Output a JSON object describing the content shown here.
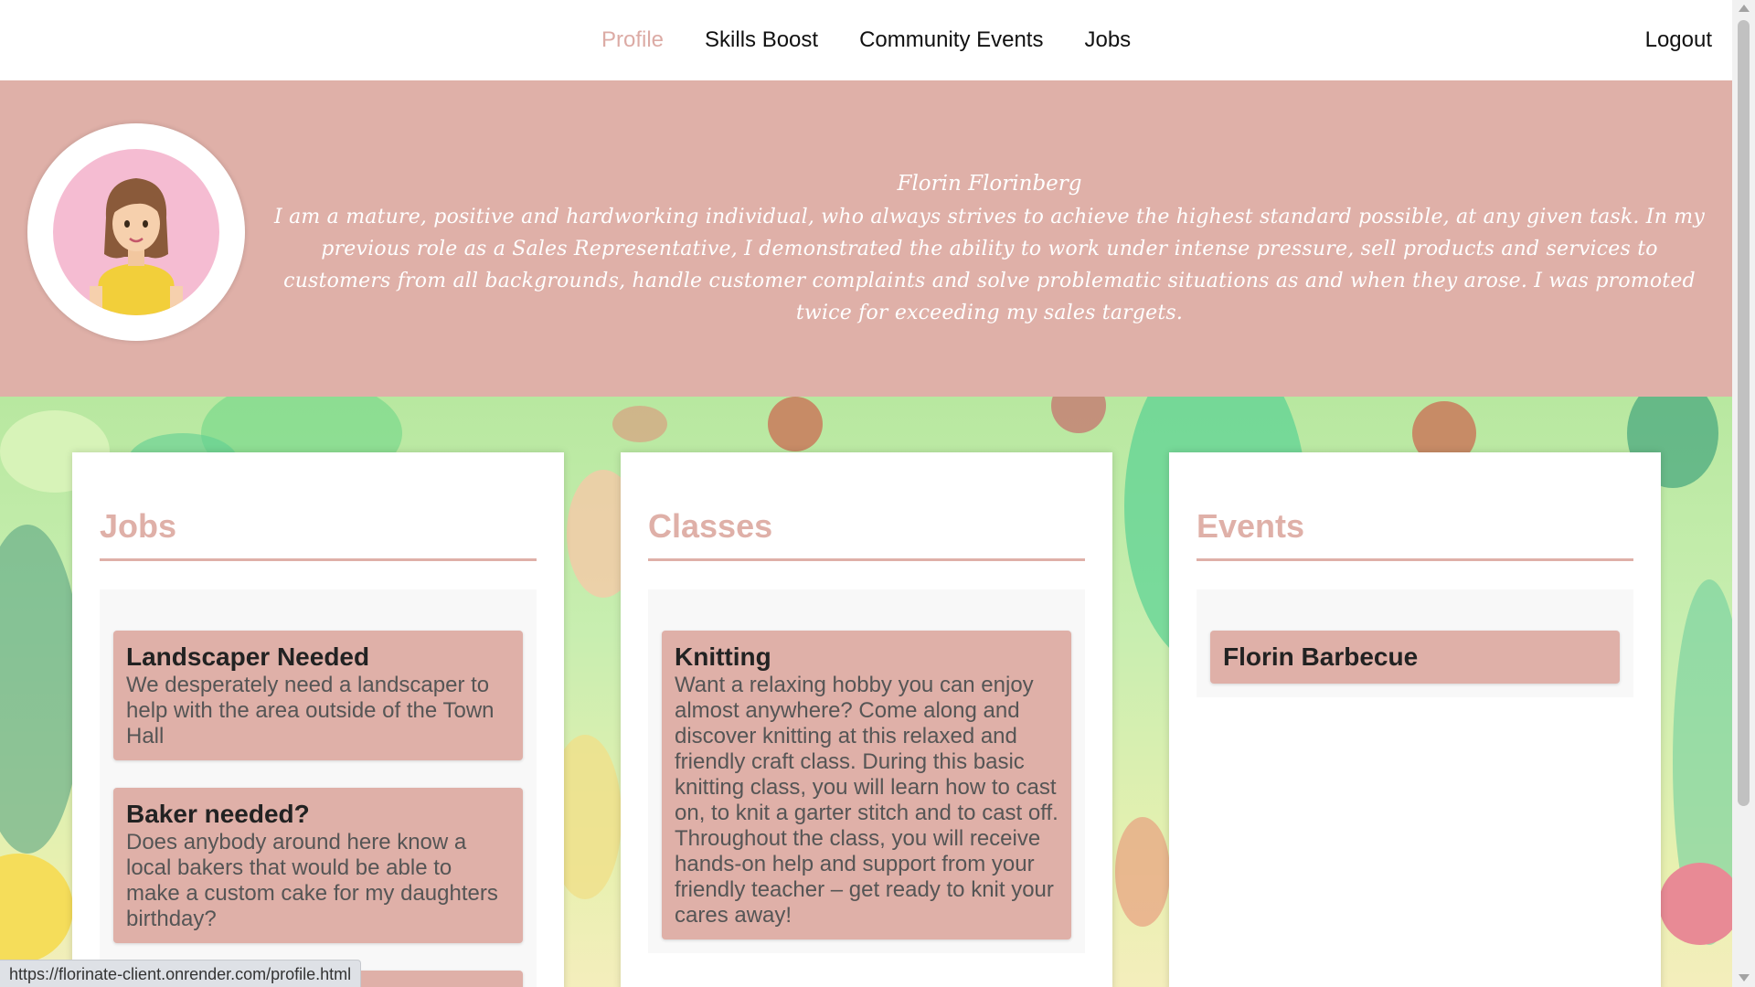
{
  "nav": {
    "links": [
      {
        "label": "Profile",
        "active": true
      },
      {
        "label": "Skills Boost",
        "active": false
      },
      {
        "label": "Community Events",
        "active": false
      },
      {
        "label": "Jobs",
        "active": false
      }
    ],
    "logout_label": "Logout"
  },
  "profile": {
    "name": "Florin Florinberg",
    "bio": "I am a mature, positive and hardworking individual, who always strives to achieve the highest standard possible, at any given task. In my previous role as a Sales Representative, I demonstrated the ability to work under intense pressure, sell products and services to customers from all backgrounds, handle customer complaints and solve problematic situations as and when they arose. I was promoted twice for exceeding my sales targets."
  },
  "cards": {
    "jobs": {
      "title": "Jobs",
      "items": [
        {
          "title": "Landscaper Needed",
          "description": "We desperately need a landscaper to help with the area outside of the Town Hall"
        },
        {
          "title": "Baker needed?",
          "description": "Does anybody around here know a local bakers that would be able to make a custom cake for my daughters birthday?"
        }
      ]
    },
    "classes": {
      "title": "Classes",
      "items": [
        {
          "title": "Knitting",
          "description": "Want a relaxing hobby you can enjoy almost anywhere? Come along and discover knitting at this relaxed and friendly craft class. During this basic knitting class, you will learn how to cast on, to knit a garter stitch and to cast off. Throughout the class, you will receive hands-on help and support from your friendly teacher – get ready to knit your cares away!"
        }
      ]
    },
    "events": {
      "title": "Events",
      "items": [
        {
          "title": "Florin Barbecue"
        }
      ]
    }
  },
  "status_bar": {
    "url": "https://florinate-client.onrender.com/profile.html"
  },
  "colors": {
    "accent": "#dfb0a8",
    "active_nav": "#dcaba5",
    "avatar_bg": "#f5bcd2"
  }
}
